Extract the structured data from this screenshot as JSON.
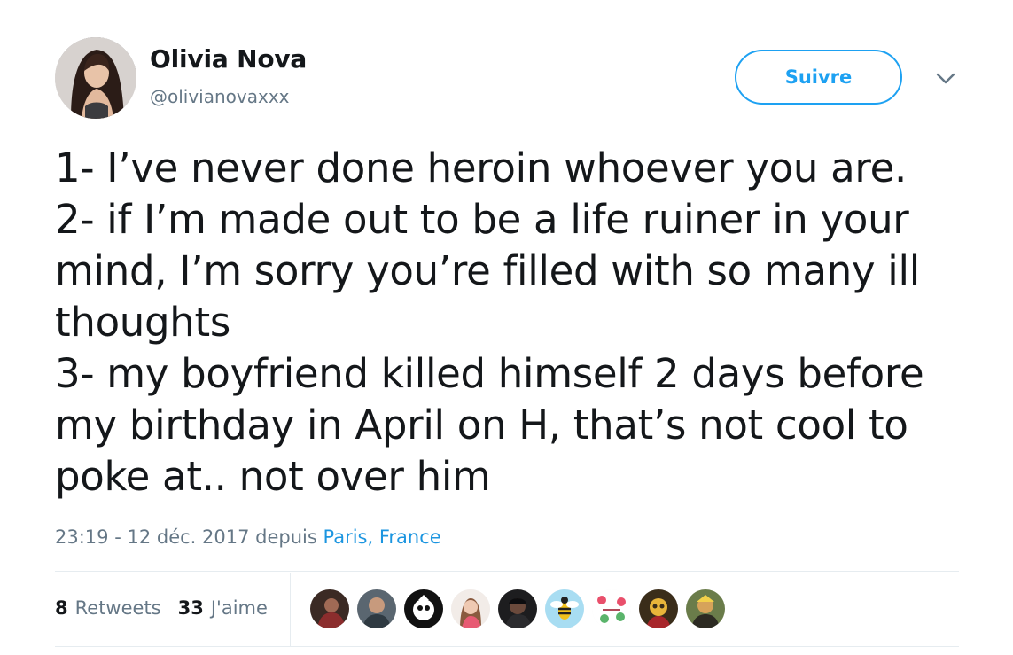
{
  "author": {
    "name": "Olivia Nova",
    "handle": "@olivianovaxxx"
  },
  "actions": {
    "follow_label": "Suivre"
  },
  "tweet": {
    "lines": [
      "1- I’ve never done heroin whoever you are.",
      "2- if I’m made out to be a life ruiner in your",
      "mind, I’m sorry you’re filled with so many ill",
      "thoughts",
      "3- my boyfriend killed himself 2 days before",
      "my birthday in April on H, that’s not cool to",
      "poke at.. not over him"
    ]
  },
  "meta": {
    "time": "23:19",
    "separator": " - ",
    "date": "12 déc. 2017",
    "via": " depuis ",
    "location": "Paris, France"
  },
  "stats": {
    "retweets_count": "8",
    "retweets_label": "Retweets",
    "likes_count": "33",
    "likes_label": "J'aime"
  },
  "icons": {
    "more": "chevron-down-icon"
  },
  "colors": {
    "accent": "#1da1f2",
    "link": "#1b95e0",
    "muted": "#657786",
    "text": "#14171a",
    "divider": "#e6ecf0"
  }
}
